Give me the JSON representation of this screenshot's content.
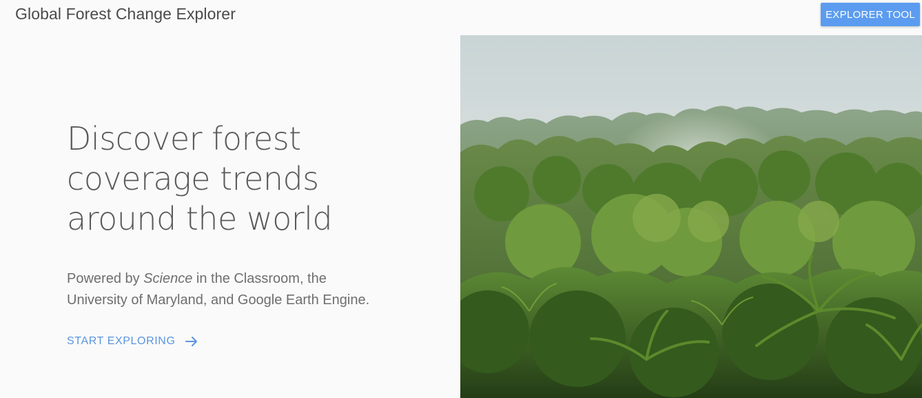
{
  "header": {
    "title": "Global Forest Change Explorer",
    "explorer_button_label": "EXPLORER TOOL"
  },
  "hero": {
    "headline_lines": [
      "Discover forest",
      "coverage trends",
      "around the world"
    ],
    "powered_prefix": "Powered by ",
    "powered_italic": "Science",
    "powered_mid": " in the Classroom, the",
    "powered_line2": "University of Maryland, and Google Earth Engine.",
    "cta_label": "START EXPLORING",
    "cta_icon": "arrow-right-icon",
    "image_icon": "rainforest-canopy-photo"
  },
  "colors": {
    "accent": "#5b9cf0",
    "link": "#5b95e0",
    "background": "#fafafa"
  }
}
